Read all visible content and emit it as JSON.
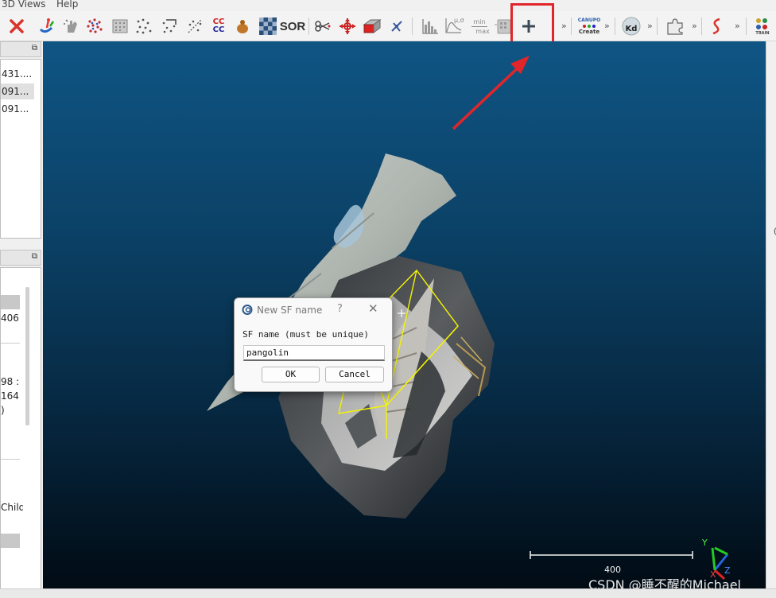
{
  "menu": {
    "items": [
      "3D Views",
      "Help"
    ]
  },
  "toolbar": {
    "tools": [
      {
        "name": "delete-icon"
      },
      {
        "name": "normals-icon"
      },
      {
        "name": "smooth-hand-icon"
      },
      {
        "name": "sample-points-icon"
      },
      {
        "name": "mesh-dots-icon"
      },
      {
        "name": "scatter-dots-icon"
      },
      {
        "name": "scatter-arrow-icon"
      },
      {
        "name": "scatter-diagonal-icon"
      },
      {
        "name": "ccc-icon"
      },
      {
        "name": "bag-icon"
      },
      {
        "name": "checker-icon"
      },
      {
        "name": "sor-icon"
      },
      {
        "name": "scissors-icon"
      },
      {
        "name": "translate-icon"
      },
      {
        "name": "plane-box-icon"
      },
      {
        "name": "axis-icon"
      },
      {
        "name": "histogram-icon"
      },
      {
        "name": "stat-fit-icon"
      },
      {
        "name": "minmax-icon"
      },
      {
        "name": "sf-arithmetic-icon"
      },
      {
        "name": "add-sf-icon"
      },
      {
        "name": "canupo-icon"
      },
      {
        "name": "kd-icon"
      },
      {
        "name": "puzzle-icon"
      },
      {
        "name": "curve-icon"
      },
      {
        "name": "plugin-icon"
      }
    ],
    "text": {
      "sor": "SOR",
      "ccc_top": "CC",
      "ccc_bottom": "CC",
      "minmax_top": "min",
      "minmax_bottom": "max",
      "stat_label": "μ,σ",
      "canupo_top": "CANUPO",
      "canupo_bottom": "Create",
      "kd": "Kd",
      "train": "TRAIN",
      "more": "»"
    }
  },
  "db_tree": {
    "items": [
      "431....",
      "091...",
      "091..."
    ],
    "dock_glyph": "⧉"
  },
  "properties": {
    "rows": [
      "406",
      "98 :",
      "164",
      ")",
      "Child"
    ],
    "dock_glyph": "⧉"
  },
  "viewport": {
    "scale_label": "400",
    "axes": {
      "x": "X",
      "y": "Y",
      "z": "Z"
    },
    "watermark": "CSDN @睡不醒的Michael",
    "right_glyph": "("
  },
  "dialog": {
    "title": "New SF name",
    "help": "?",
    "close": "✕",
    "label": "SF name (must be unique)",
    "input_value": "pangolin",
    "ok": "OK",
    "cancel": "Cancel"
  },
  "colors": {
    "highlight": "#e0262a",
    "arrow": "#e0262a",
    "viewport_top": "#0f5584",
    "viewport_bottom": "#010b14",
    "bbox_lines": "#f4f400"
  }
}
